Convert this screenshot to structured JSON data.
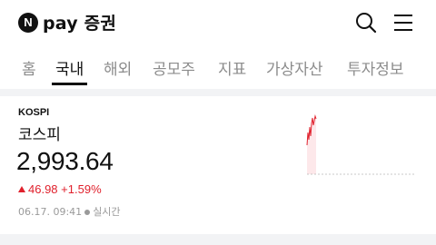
{
  "header": {
    "logo_badge": "N",
    "logo_text": "pay 증권"
  },
  "tabs": [
    {
      "label": "홈",
      "active": false
    },
    {
      "label": "국내",
      "active": true
    },
    {
      "label": "해외",
      "active": false
    },
    {
      "label": "공모주",
      "active": false
    },
    {
      "label": "지표",
      "active": false
    },
    {
      "label": "가상자산",
      "active": false
    },
    {
      "label": "투자정보",
      "active": false
    }
  ],
  "index_card": {
    "code": "KOSPI",
    "name": "코스피",
    "value": "2,993.64",
    "change": "46.98",
    "change_percent": "+1.59%",
    "date_time": "06.17. 09:41",
    "status": "실시간"
  },
  "colors": {
    "up": "#e0202c",
    "chart_fill": "#fde8ea"
  }
}
